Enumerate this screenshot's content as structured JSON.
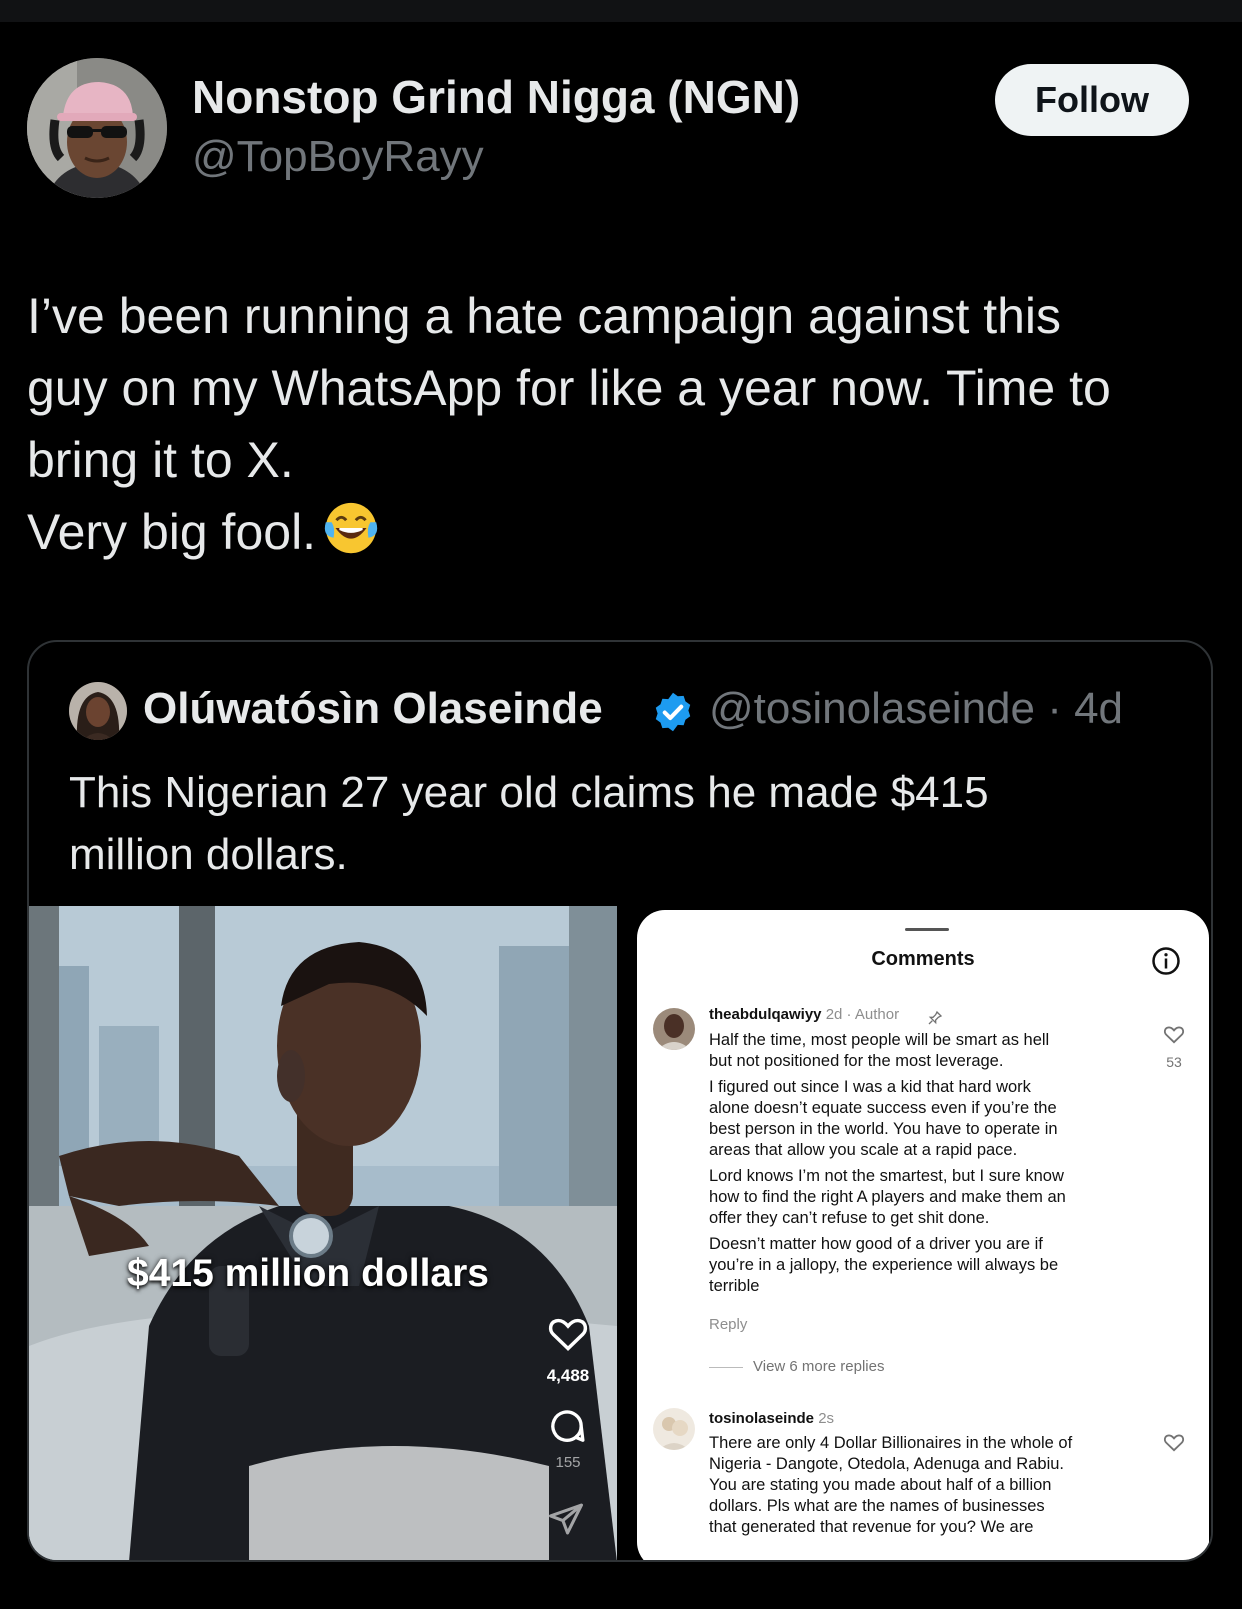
{
  "author": {
    "display_name": "Nonstop Grind Nigga (NGN)",
    "handle": "@TopBoyRayy"
  },
  "follow_label": "Follow",
  "tweet": {
    "lines": [
      "I’ve been running a hate campaign against this",
      "guy on my WhatsApp for like a year now. Time to",
      "bring it to X.",
      "Very big fool."
    ],
    "emoji": "face-with-tears-of-joy"
  },
  "quoted": {
    "display_name": "Olúwatósìn Olaseinde",
    "handle_time": "@tosinolaseinde · 4d",
    "text_lines": [
      "This Nigerian 27 year old claims he made $415",
      "million dollars."
    ],
    "media": {
      "video": {
        "caption": "$415 million dollars",
        "like_count": "4,488",
        "comment_count": "155"
      },
      "comments_panel": {
        "title": "Comments",
        "comments": [
          {
            "username": "theabdulqawiyy",
            "meta": "2d · Author",
            "paragraphs": [
              [
                "Half the time, most people will be smart as hell",
                "but not positioned for the most leverage."
              ],
              [
                "I figured out since I was a kid that hard work",
                "alone doesn’t equate success even if you’re the",
                "best person in the world. You have to operate in",
                "areas that allow you scale at a rapid pace."
              ],
              [
                "Lord knows I’m not the smartest, but I sure know",
                "how to find the right A players and make them an",
                "offer they can’t refuse to get shit done."
              ],
              [
                "Doesn’t matter how good of a driver you are if",
                "you’re in a jallopy, the experience will always be",
                "terrible"
              ]
            ],
            "reply_label": "Reply",
            "like_count": "53",
            "view_more": "View 6 more replies"
          },
          {
            "username": "tosinolaseinde",
            "meta": "2s",
            "lines": [
              "There are only 4 Dollar Billionaires in the whole of",
              "Nigeria - Dangote, Otedola, Adenuga and Rabiu.",
              "You are stating you made about half of a billion",
              "dollars. Pls what are the names of businesses",
              "that generated that revenue for you? We are"
            ]
          }
        ]
      }
    }
  },
  "colors": {
    "background": "#000000",
    "text": "#e7e9ea",
    "secondary": "#71767b",
    "verified": "#1d9bf0",
    "border": "#2f3336"
  }
}
